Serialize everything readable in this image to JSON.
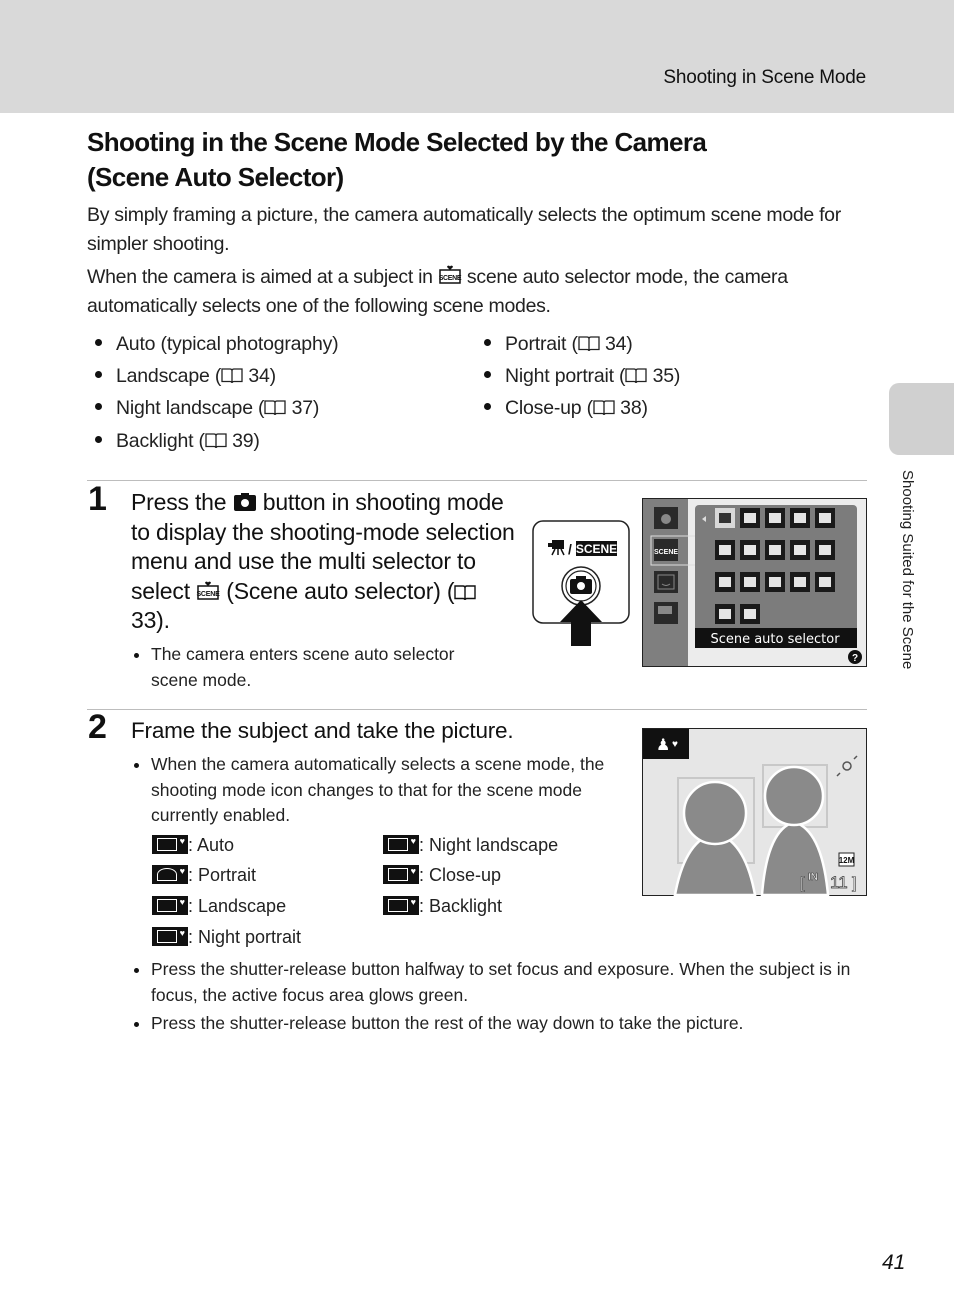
{
  "header": {
    "section_title": "Shooting in Scene Mode"
  },
  "page_title": {
    "line1": "Shooting in the Scene Mode Selected by the Camera",
    "line2": "(Scene Auto Selector)"
  },
  "intro": {
    "p1": "By simply framing a picture, the camera automatically selects the optimum scene mode for simpler shooting.",
    "p2_before": "When the camera is aimed at a subject in ",
    "p2_icon": "scene-auto-selector-icon",
    "p2_after": " scene auto selector mode, the camera automatically selects one of the following scene modes."
  },
  "scene_modes": {
    "left": [
      {
        "label": "Auto (typical photography)",
        "page": ""
      },
      {
        "label": "Landscape (",
        "page": "34)"
      },
      {
        "label": "Night landscape (",
        "page": "37)"
      },
      {
        "label": "Backlight (",
        "page": "39)"
      }
    ],
    "right": [
      {
        "label": "Portrait (",
        "page": "34)"
      },
      {
        "label": "Night portrait (",
        "page": "35)"
      },
      {
        "label": "Close-up (",
        "page": "38)"
      }
    ]
  },
  "step1": {
    "number": "1",
    "text_a": "Press the ",
    "text_b": " button in shooting mode to display the shooting-mode selection menu and use the multi selector to select ",
    "text_c": " (Scene auto selector) (",
    "text_d": " 33).",
    "bullet": "The camera enters scene auto selector scene mode.",
    "figure": {
      "button_label": "SCENE",
      "menu_caption": "Scene auto selector",
      "help_icon": "?"
    }
  },
  "step2": {
    "number": "2",
    "title": "Frame the subject and take the picture.",
    "bullet1": "When the camera automatically selects a scene mode, the shooting mode icon changes to that for the scene mode currently enabled.",
    "legend": [
      {
        "icon": "auto-icon",
        "label": ": Auto"
      },
      {
        "icon": "portrait-icon",
        "label": ": Portrait"
      },
      {
        "icon": "landscape-icon",
        "label": ": Landscape"
      },
      {
        "icon": "night-portrait-icon",
        "label": ": Night portrait"
      },
      {
        "icon": "night-landscape-icon",
        "label": ": Night landscape"
      },
      {
        "icon": "close-up-icon",
        "label": ": Close-up"
      },
      {
        "icon": "backlight-icon",
        "label": ": Backlight"
      }
    ],
    "bullet2": "Press the shutter-release button halfway to set focus and exposure. When the subject is in focus, the active focus area glows green.",
    "bullet3": "Press the shutter-release button the rest of the way down to take the picture.",
    "monitor": {
      "image_size": "12M",
      "memory": "IN",
      "remaining": "11"
    }
  },
  "side_tab": {
    "label": "Shooting Suited for the Scene"
  },
  "page_number": "41"
}
